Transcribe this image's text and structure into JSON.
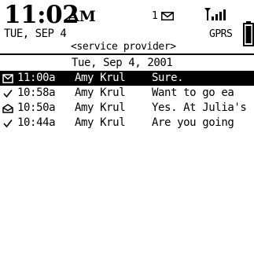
{
  "status_bar": {
    "time": "11:02",
    "ampm": "AM",
    "date": "TUE, SEP 4",
    "message_count": "1",
    "network": "GPRS",
    "service_provider": "<service provider>"
  },
  "message_list": {
    "date_header": "Tue, Sep 4, 2001",
    "rows": [
      {
        "status_icon": "envelope-unread-icon",
        "time": "11:00a",
        "sender": "Amy Krul",
        "subject": "Sure.",
        "selected": true
      },
      {
        "status_icon": "checkmark-sent-icon",
        "time": "10:58a",
        "sender": "Amy Krul",
        "subject": "Want to go ea",
        "selected": false
      },
      {
        "status_icon": "envelope-opened-icon",
        "time": "10:50a",
        "sender": "Amy Krul",
        "subject": "Yes. At Julia's",
        "selected": false
      },
      {
        "status_icon": "checkmark-sent-icon",
        "time": "10:44a",
        "sender": "Amy Krul",
        "subject": "Are you going",
        "selected": false
      }
    ]
  },
  "colors": {
    "background": "#ffffff",
    "foreground": "#000000",
    "selection": "#000000"
  }
}
